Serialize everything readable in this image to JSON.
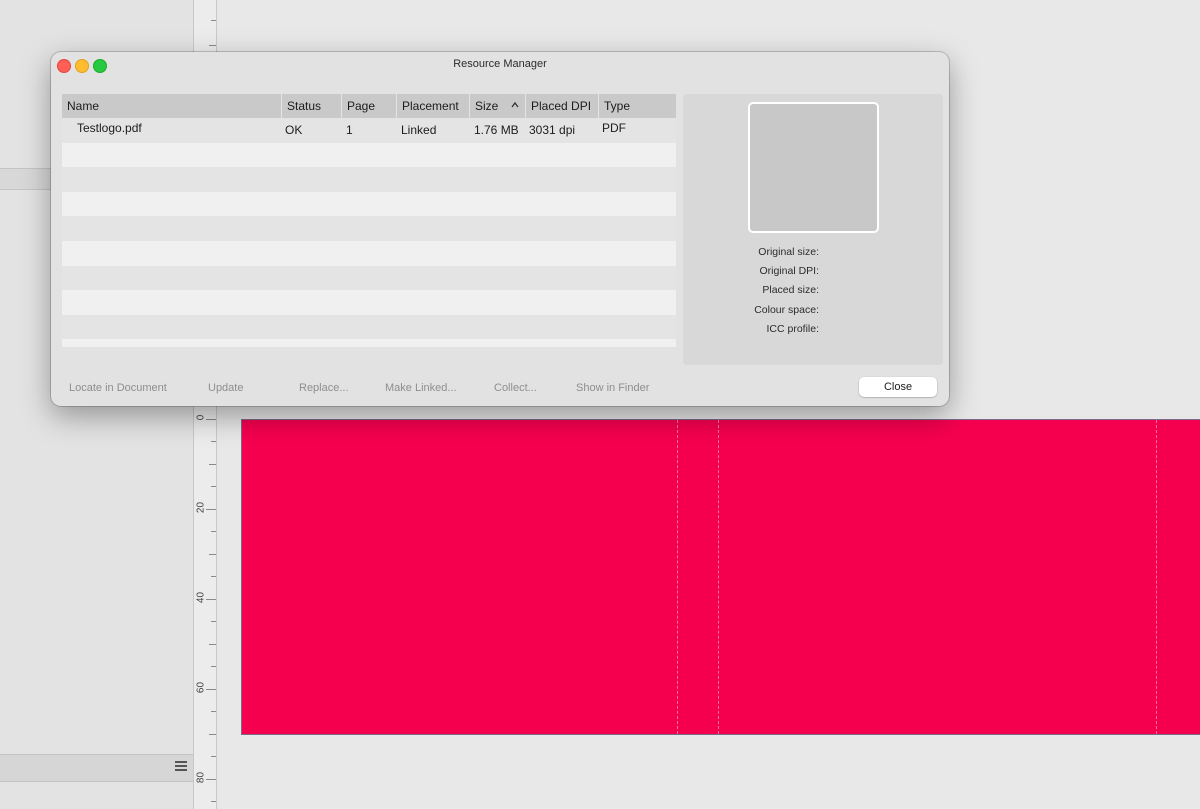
{
  "window": {
    "title": "Resource Manager"
  },
  "table": {
    "columns": [
      "Name",
      "Status",
      "Page",
      "Placement",
      "Size",
      "Placed DPI",
      "Type"
    ],
    "rows": [
      {
        "name": "Testlogo.pdf",
        "status": "OK",
        "page": "1",
        "placement": "Linked",
        "size": "1.76 MB",
        "placed_dpi": "3031 dpi",
        "type": "PDF"
      }
    ],
    "sorted_column": "Size",
    "sort_icon": "chevron-up-icon"
  },
  "details": {
    "original_size_label": "Original size:",
    "original_dpi_label": "Original DPI:",
    "placed_size_label": "Placed size:",
    "colour_space_label": "Colour space:",
    "icc_profile_label": "ICC profile:"
  },
  "actions": {
    "locate": "Locate in Document",
    "update": "Update",
    "replace": "Replace...",
    "make_linked": "Make Linked...",
    "collect": "Collect...",
    "show_in_finder": "Show in Finder",
    "close": "Close"
  },
  "ruler": {
    "labels": [
      "0",
      "20",
      "40",
      "60",
      "80"
    ]
  },
  "colors": {
    "page_fill": "#f5004f",
    "traffic_close": "#fe5f57",
    "traffic_minimize": "#febc2e",
    "traffic_maximize": "#28c840"
  }
}
